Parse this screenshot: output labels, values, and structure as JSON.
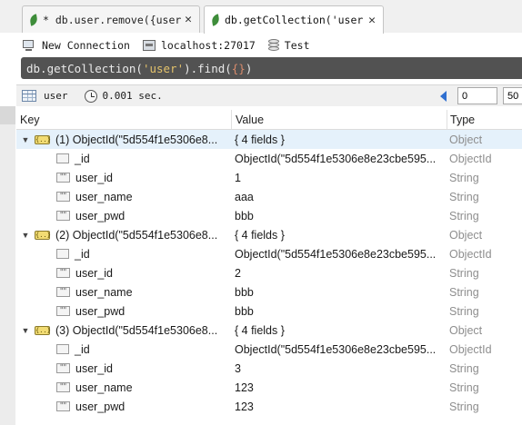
{
  "tabs": [
    {
      "title": "* db.user.remove({user_id:",
      "close": "✕",
      "active": false
    },
    {
      "title": "db.getCollection('user').",
      "close": "✕",
      "active": true
    }
  ],
  "connection": {
    "name": "New Connection",
    "host": "localhost:27017",
    "database": "Test"
  },
  "query": {
    "prefix": "db.getCollection(",
    "collection": "'user'",
    "method": ").find(",
    "arg": "{}",
    "suffix": ")"
  },
  "result_info": {
    "collection": "user",
    "time": "0.001 sec.",
    "skip": "0",
    "limit": "50"
  },
  "columns": {
    "key": "Key",
    "value": "Value",
    "type": "Type"
  },
  "documents": [
    {
      "label": "(1) ObjectId(\"5d554f1e5306e8...",
      "value": "{ 4 fields }",
      "type": "Object",
      "fields": [
        {
          "key": "_id",
          "value": "ObjectId(\"5d554f1e5306e8e23cbe595...",
          "type": "ObjectId",
          "icon": "objectid"
        },
        {
          "key": "user_id",
          "value": "1",
          "type": "String",
          "icon": "string"
        },
        {
          "key": "user_name",
          "value": "aaa",
          "type": "String",
          "icon": "string"
        },
        {
          "key": "user_pwd",
          "value": "bbb",
          "type": "String",
          "icon": "string"
        }
      ]
    },
    {
      "label": "(2) ObjectId(\"5d554f1e5306e8...",
      "value": "{ 4 fields }",
      "type": "Object",
      "fields": [
        {
          "key": "_id",
          "value": "ObjectId(\"5d554f1e5306e8e23cbe595...",
          "type": "ObjectId",
          "icon": "objectid"
        },
        {
          "key": "user_id",
          "value": "2",
          "type": "String",
          "icon": "string"
        },
        {
          "key": "user_name",
          "value": "bbb",
          "type": "String",
          "icon": "string"
        },
        {
          "key": "user_pwd",
          "value": "bbb",
          "type": "String",
          "icon": "string"
        }
      ]
    },
    {
      "label": "(3) ObjectId(\"5d554f1e5306e8...",
      "value": "{ 4 fields }",
      "type": "Object",
      "fields": [
        {
          "key": "_id",
          "value": "ObjectId(\"5d554f1e5306e8e23cbe595...",
          "type": "ObjectId",
          "icon": "objectid"
        },
        {
          "key": "user_id",
          "value": "3",
          "type": "String",
          "icon": "string"
        },
        {
          "key": "user_name",
          "value": "123",
          "type": "String",
          "icon": "string"
        },
        {
          "key": "user_pwd",
          "value": "123",
          "type": "String",
          "icon": "string"
        }
      ]
    }
  ],
  "colors": {
    "query_bg": "#525252",
    "selected_row": "#e5f1fb",
    "type_text": "#8e8e8e",
    "leaf": "#3e8d3a"
  }
}
